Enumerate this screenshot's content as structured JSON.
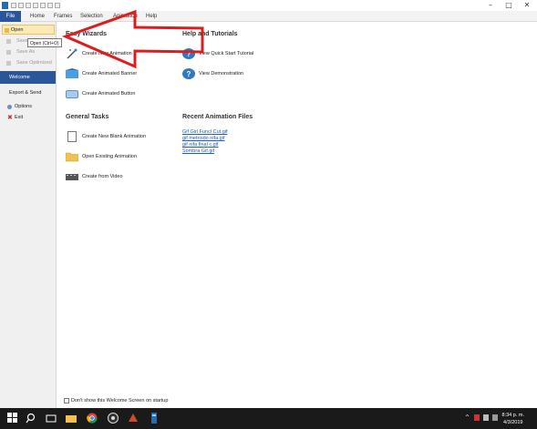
{
  "ribbon": {
    "tabs": [
      "File",
      "Home",
      "Frames",
      "Selection",
      "Animation",
      "Help"
    ]
  },
  "sidebar": {
    "items": [
      {
        "label": "Open",
        "state": "hover"
      },
      {
        "label": "Save",
        "state": "disabled"
      },
      {
        "label": "Save As",
        "state": "disabled"
      },
      {
        "label": "Save Optimized",
        "state": "disabled"
      },
      {
        "label": "Welcome",
        "state": "selected"
      },
      {
        "label": "Export & Send",
        "state": "normal"
      },
      {
        "label": "Options",
        "state": "normal"
      },
      {
        "label": "Exit",
        "state": "normal"
      }
    ],
    "tooltip": "Open (Ctrl+O)"
  },
  "main": {
    "easy_wizards": {
      "title": "Easy Wizards",
      "items": [
        "Create New Animation",
        "Create Animated Banner",
        "Create Animated Button"
      ]
    },
    "general_tasks": {
      "title": "General Tasks",
      "items": [
        "Create New Blank Animation",
        "Open Existing Animation",
        "Create from Video"
      ]
    },
    "help": {
      "title": "Help and Tutorials",
      "items": [
        "View Quick Start Tutorial",
        "View Demonstration"
      ]
    },
    "recent": {
      "title": "Recent Animation Files",
      "files": [
        "Gif Girl Funcl Cut.gif",
        "gif metroido nifa.gif",
        "gif nifa final c.gif",
        "Sombra Gif.gif"
      ]
    },
    "footer_checkbox": "Don't show this Welcome Screen on startup"
  },
  "taskbar": {
    "time": "8:34 p. m.",
    "date": "4/3/2019"
  },
  "colors": {
    "accent": "#2b579a",
    "arrow": "#e01b1b",
    "link": "#1f5dbe"
  },
  "icons": {
    "wizard": "magic-wand-icon",
    "banner": "banner-icon",
    "button": "button-icon",
    "blank": "blank-page-icon",
    "folder": "folder-icon",
    "video": "video-icon",
    "help": "help-icon"
  }
}
